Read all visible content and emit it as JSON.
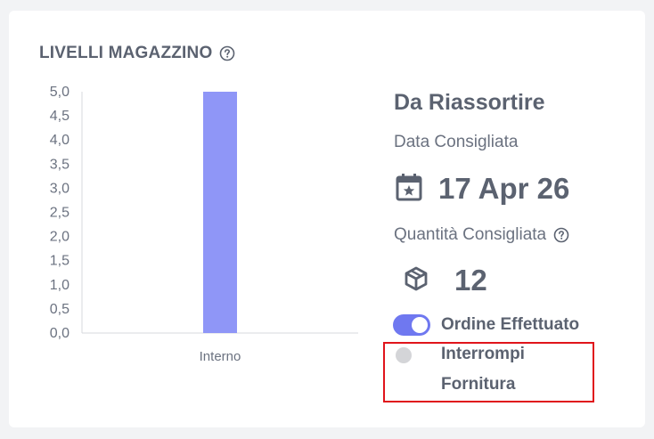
{
  "card": {
    "title": "LIVELLI MAGAZZINO",
    "help_icon": "question-circle-icon"
  },
  "chart_data": {
    "type": "bar",
    "categories": [
      "Interno"
    ],
    "values": [
      5.0
    ],
    "ylim": [
      0,
      5
    ],
    "yticks": [
      "0,0",
      "0,5",
      "1,0",
      "1,5",
      "2,0",
      "2,5",
      "3,0",
      "3,5",
      "4,0",
      "4,5",
      "5,0"
    ],
    "bar_color": "#8f96f7",
    "grid": false
  },
  "restock": {
    "title": "Da Riassortire",
    "date_label": "Data Consigliata",
    "date_icon": "calendar-star-icon",
    "date_value": "17 Apr 26",
    "qty_label": "Quantità Consigliata",
    "qty_icon": "box-icon",
    "qty_value": "12"
  },
  "toggles": {
    "order_label": "Ordine Effettuato",
    "order_on": true,
    "stop_label": "Interrompi Fornitura",
    "stop_on": false
  },
  "colors": {
    "accent": "#6f78f0",
    "highlight": "#e0141b"
  }
}
